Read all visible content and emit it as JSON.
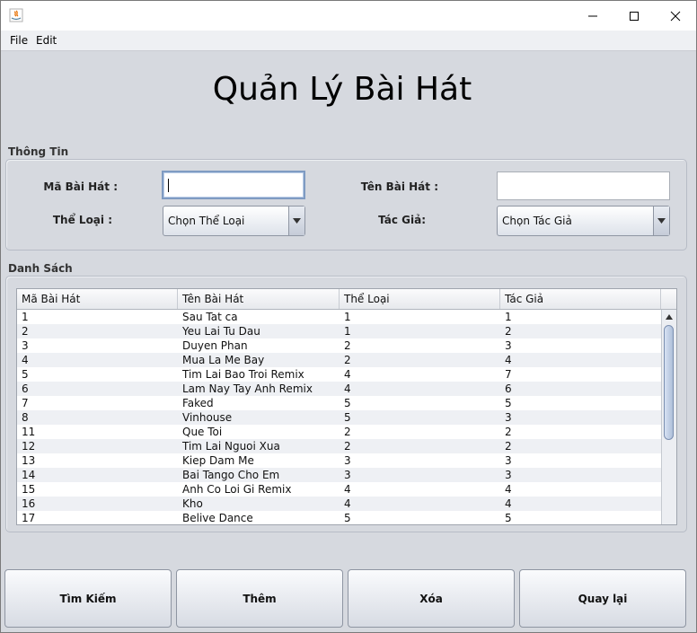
{
  "menu": {
    "file": "File",
    "edit": "Edit"
  },
  "page_title": "Quản Lý Bài Hát",
  "info": {
    "group_label": "Thông Tin",
    "ma_label": "Mã Bài Hát :",
    "ten_label": "Tên Bài Hát :",
    "the_loai_label": "Thể Loại :",
    "tac_gia_label": "Tác Giả:",
    "ma_value": "",
    "ten_value": "",
    "the_loai_selected": "Chọn Thể Loại",
    "tac_gia_selected": "Chọn Tác Giả"
  },
  "list": {
    "group_label": "Danh Sách",
    "columns": [
      "Mã Bài Hát",
      "Tên Bài Hát",
      "Thể Loại",
      "Tác Giả"
    ],
    "rows": [
      [
        "1",
        "Sau Tat ca",
        "1",
        "1"
      ],
      [
        "2",
        "Yeu Lai Tu Dau",
        "1",
        "2"
      ],
      [
        "3",
        "Duyen Phan",
        "2",
        "3"
      ],
      [
        "4",
        "Mua La Me Bay",
        "2",
        "4"
      ],
      [
        "5",
        "Tim Lai Bao Troi Remix",
        "4",
        "7"
      ],
      [
        "6",
        "Lam Nay Tay Anh Remix",
        "4",
        "6"
      ],
      [
        "7",
        "Faked",
        "5",
        "5"
      ],
      [
        "8",
        "Vinhouse",
        "5",
        "3"
      ],
      [
        "11",
        "Que Toi",
        "2",
        "2"
      ],
      [
        "12",
        "Tim Lai Nguoi Xua",
        "2",
        "2"
      ],
      [
        "13",
        "Kiep Dam Me",
        "3",
        "3"
      ],
      [
        "14",
        "Bai Tango Cho Em",
        "3",
        "3"
      ],
      [
        "15",
        "Anh Co Loi Gi Remix",
        "4",
        "4"
      ],
      [
        "16",
        "Kho",
        "4",
        "4"
      ],
      [
        "17",
        "Belive Dance",
        "5",
        "5"
      ]
    ]
  },
  "buttons": {
    "search": "Tìm Kiếm",
    "add": "Thêm",
    "delete": "Xóa",
    "back": "Quay lại"
  }
}
